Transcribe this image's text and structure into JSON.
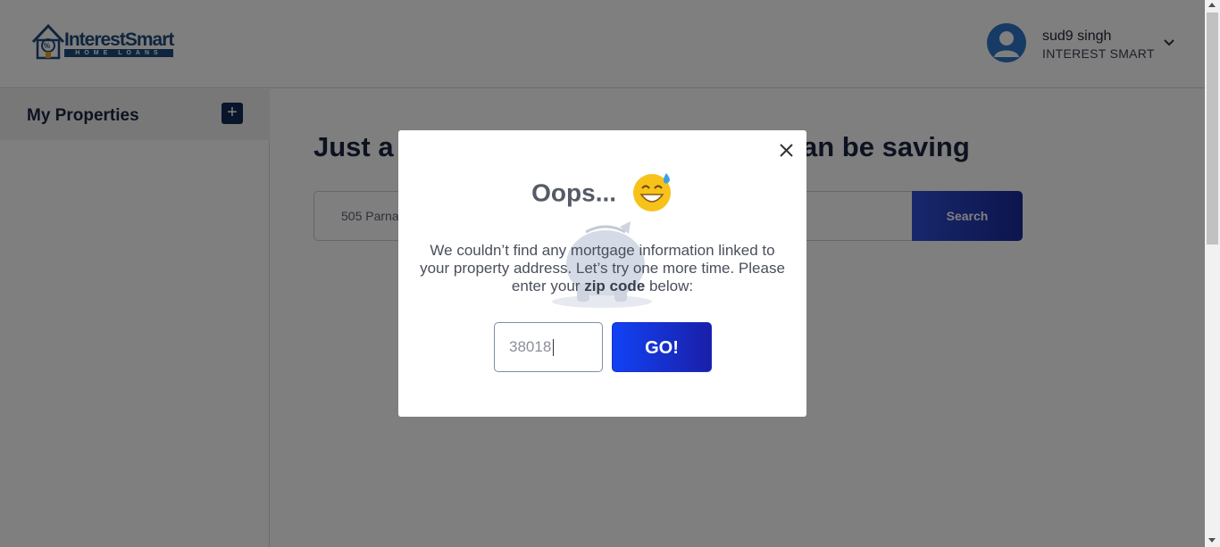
{
  "header": {
    "logo": {
      "name": "InterestSmart",
      "tagline": "HOME LOANS"
    },
    "user": {
      "name": "sud9 singh",
      "org": "INTEREST SMART"
    }
  },
  "sidebar": {
    "title": "My Properties",
    "add_label": "+"
  },
  "main": {
    "headline_visible_left": "Just a",
    "headline_visible_right": "an be saving",
    "search_value": "505 Parna",
    "search_button": "Search"
  },
  "modal": {
    "title": "Oops...",
    "emoji_icon": "grinning-sweat-emoji-icon",
    "message_part1": "We couldn’t find any mortgage information linked to your property address. Let’s try one more time. Please enter your",
    "message_bold": "zip code",
    "message_part2": "below:",
    "zip_value": "38018",
    "go_label": "GO!"
  },
  "colors": {
    "brand_navy": "#102a57",
    "button_blue_start": "#1242f5",
    "button_blue_end": "#1a1fa8",
    "avatar_blue": "#2f77c8"
  }
}
